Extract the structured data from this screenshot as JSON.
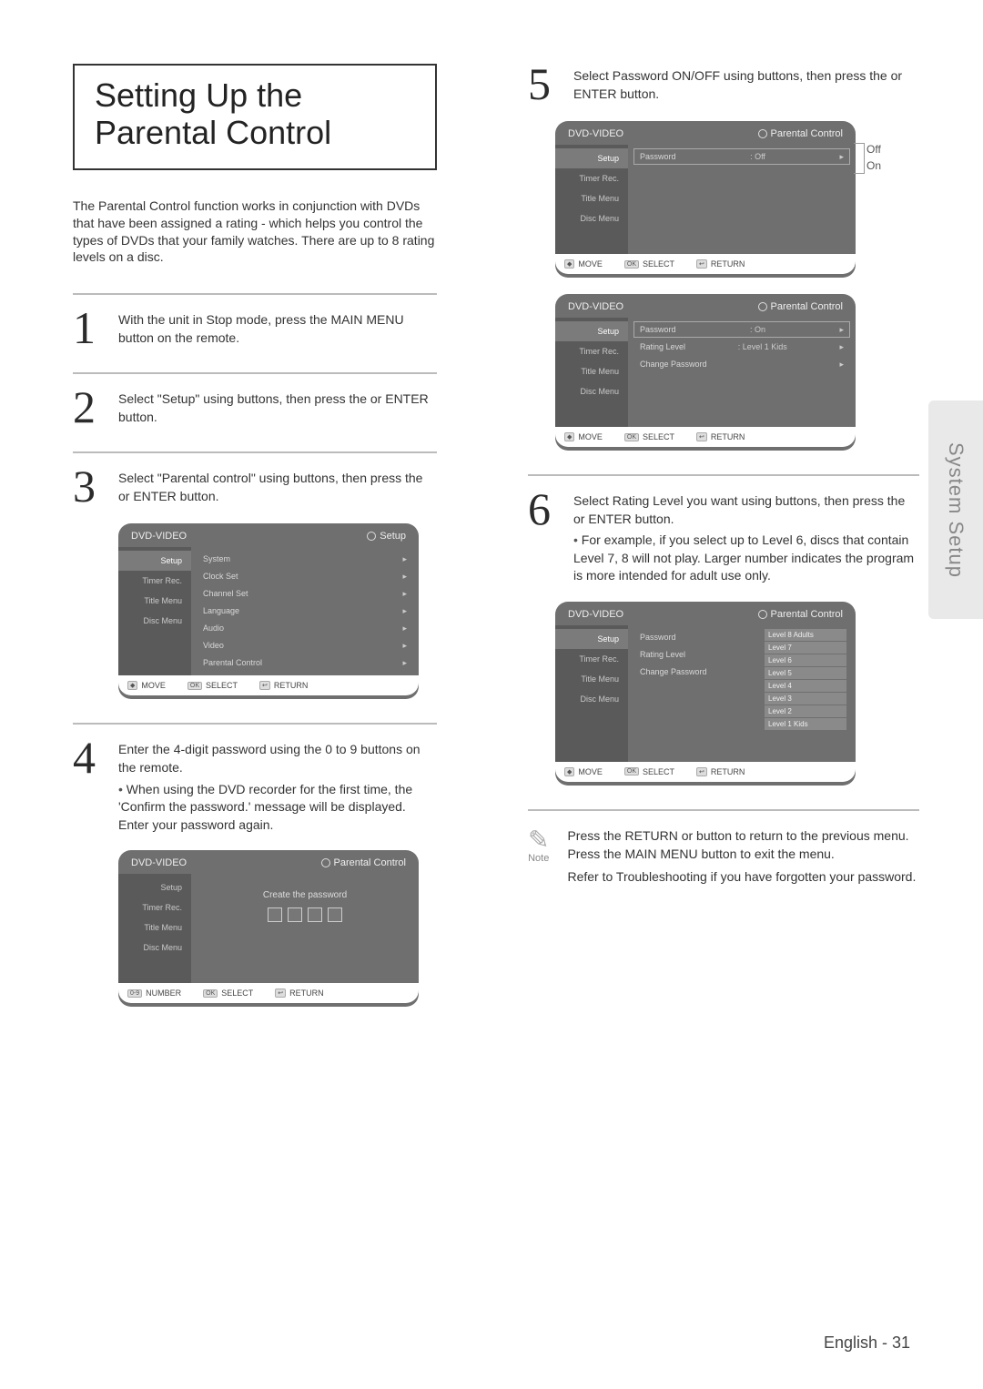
{
  "page": {
    "title": "Setting Up the Parental Control",
    "intro": "The Parental Control function works in conjunction with DVDs that have been assigned a rating - which helps you control the types of DVDs that your family watches. There are up to 8 rating levels on a disc.",
    "side_tab": "System Setup",
    "footer": "English - 31"
  },
  "steps": {
    "s1": {
      "num": "1",
      "text": "With the unit in Stop mode, press the MAIN MENU button on the remote."
    },
    "s2": {
      "num": "2",
      "text": "Select \"Setup\" using        buttons, then press the     or ENTER button."
    },
    "s3": {
      "num": "3",
      "text": "Select \"Parental control\" using        buttons, then press the     or ENTER button."
    },
    "s4": {
      "num": "4",
      "text": "Enter the 4-digit password using the 0 to 9 buttons on the remote.",
      "sub": "When using the DVD recorder for the first time, the 'Confirm the password.' message will be displayed. Enter your password again."
    },
    "s5": {
      "num": "5",
      "text": "Select Password ON/OFF using        buttons, then press the     or ENTER button."
    },
    "s6": {
      "num": "6",
      "text": "Select Rating Level you want using        buttons, then press the     or ENTER button.",
      "sub": "For example, if you select up to Level 6, discs that contain Level 7, 8 will not play. Larger number indicates the program is more intended for adult use only."
    }
  },
  "note": {
    "label": "Note",
    "text1": "Press the RETURN or     button to return to the previous menu. Press the MAIN MENU button to exit the menu.",
    "text2": "Refer to Troubleshooting if you have forgotten your password."
  },
  "osd": {
    "title": "DVD-VIDEO",
    "crumb_setup": "Setup",
    "crumb_pc": "Parental Control",
    "side": {
      "setup": "Setup",
      "timer": "Timer Rec.",
      "title": "Title Menu",
      "disc": "Disc Menu"
    },
    "setup_items": {
      "system": "System",
      "clock": "Clock Set",
      "channel": "Channel Set",
      "language": "Language",
      "audio": "Audio",
      "video": "Video",
      "parental": "Parental Control"
    },
    "pc_items": {
      "password": "Password",
      "rating": "Rating Level",
      "change": "Change Password",
      "val_off": ": Off",
      "val_on": ": On",
      "val_level1": ": Level 1 Kids"
    },
    "create_password": "Create the password",
    "levels": {
      "l8": "Level 8 Adults",
      "l7": "Level 7",
      "l6": "Level 6",
      "l5": "Level 5",
      "l4": "Level 4",
      "l3": "Level 3",
      "l2": "Level 2",
      "l1": "Level 1 Kids"
    },
    "foot": {
      "move": "MOVE",
      "select": "SELECT",
      "return": "RETURN",
      "number": "NUMBER"
    },
    "offon": {
      "off": "Off",
      "on": "On"
    }
  }
}
